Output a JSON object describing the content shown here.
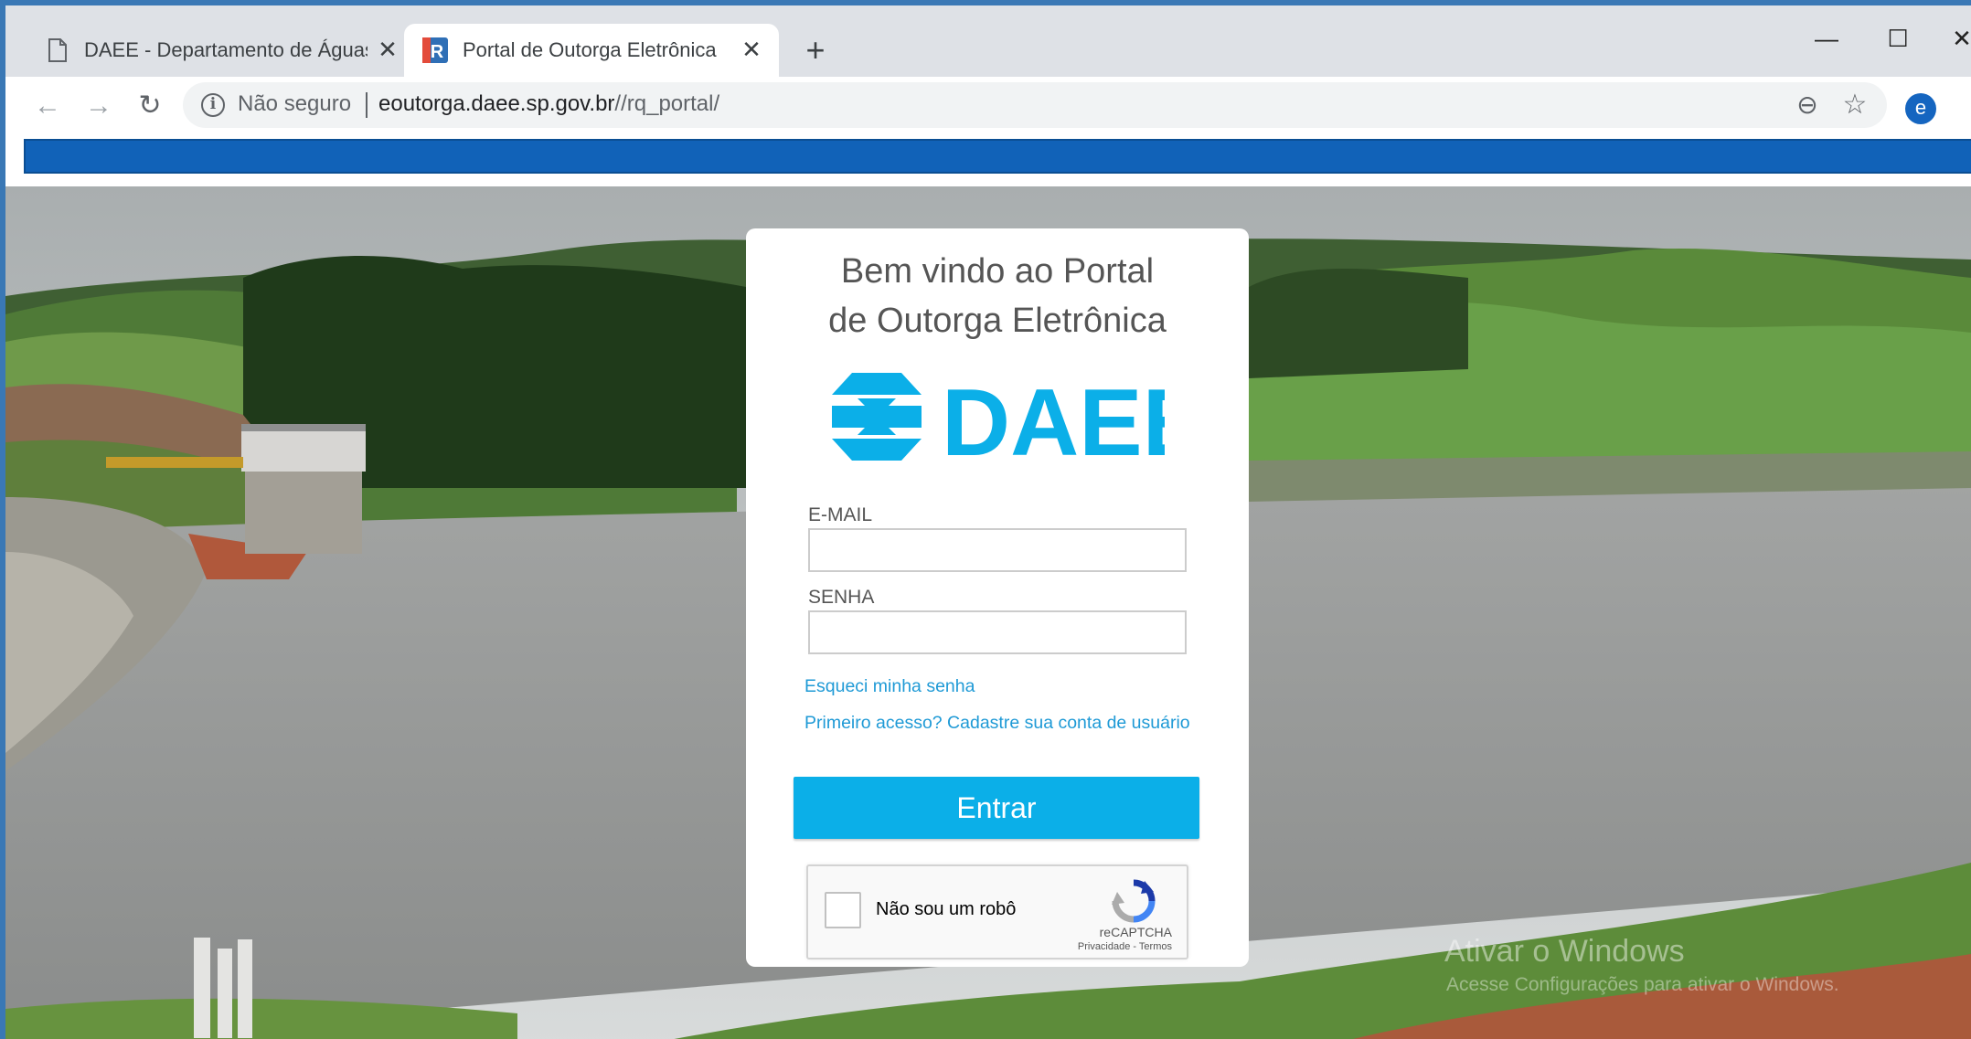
{
  "browser": {
    "tabs": [
      {
        "title": "DAEE - Departamento de Águas e Energia Elétrica",
        "active": false
      },
      {
        "title": "Portal de Outorga Eletrônica",
        "active": true
      }
    ],
    "new_tab": "+",
    "window_controls": {
      "minimize": "—",
      "maximize": "☐",
      "close": "✕"
    },
    "security_label": "Não seguro",
    "url_host": "eoutorga.daee.sp.gov.br",
    "url_path": "//rq_portal/",
    "profile_initial": "e",
    "accent_color": "#1162b8"
  },
  "login": {
    "welcome_line1": "Bem vindo ao Portal",
    "welcome_line2": "de Outorga Eletrônica",
    "logo_text": "DAEE",
    "logo_color": "#0bafe8",
    "email_label": "E-MAIL",
    "email_value": "",
    "password_label": "SENHA",
    "password_value": "",
    "forgot_link": "Esqueci minha senha",
    "signup_link": "Primeiro acesso? Cadastre sua conta de usuário",
    "submit_label": "Entrar",
    "button_color": "#0bafe8"
  },
  "recaptcha": {
    "label": "Não sou um robô",
    "brand": "reCAPTCHA",
    "terms": "Privacidade - Termos"
  },
  "os_watermark": {
    "title": "Ativar o Windows",
    "subtitle": "Acesse Configurações para ativar o Windows."
  }
}
